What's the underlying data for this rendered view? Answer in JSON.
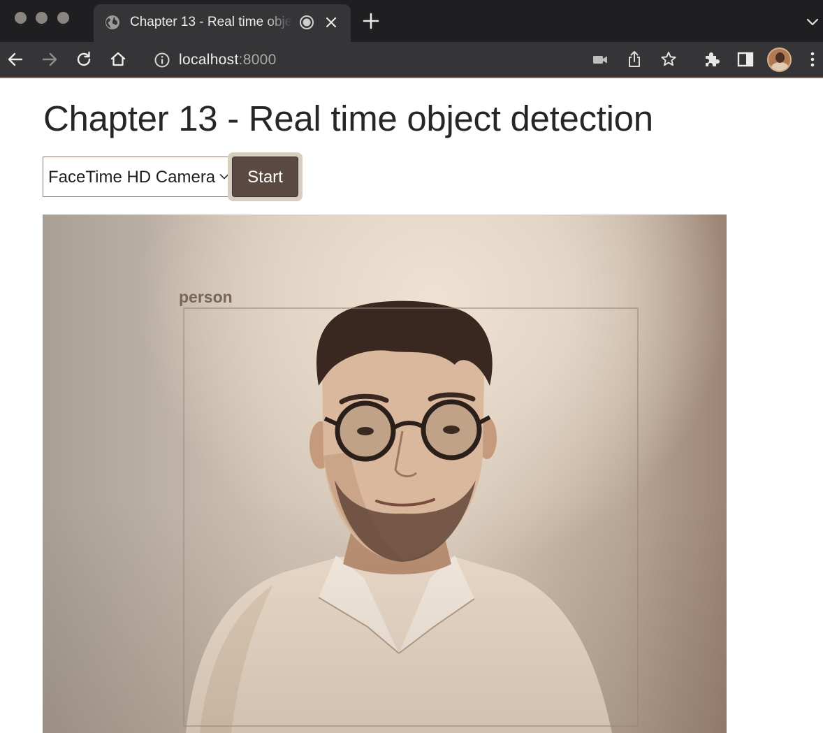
{
  "browser": {
    "tab": {
      "title": "Chapter 13 - Real time object detection",
      "icon": "globe-icon"
    },
    "url": {
      "host": "localhost",
      "port": ":8000"
    },
    "icons": [
      "back-icon",
      "forward-icon",
      "reload-icon",
      "home-icon",
      "site-info-icon",
      "camera-in-use-icon",
      "share-icon",
      "bookmark-star-icon",
      "extensions-icon",
      "side-panel-icon",
      "profile-avatar",
      "menu-icon"
    ]
  },
  "page": {
    "title": "Chapter 13 - Real time object detection",
    "camera_select": {
      "selected": "FaceTime HD Camera"
    },
    "start_button": {
      "label": "Start"
    },
    "detection": {
      "label": "person"
    }
  },
  "colors": {
    "chrome_dark": "#1f1f21",
    "chrome_toolbar": "#353537",
    "button_bg": "#5b4a44",
    "button_ring": "#d7cdc0",
    "detection_box": "#968779"
  }
}
